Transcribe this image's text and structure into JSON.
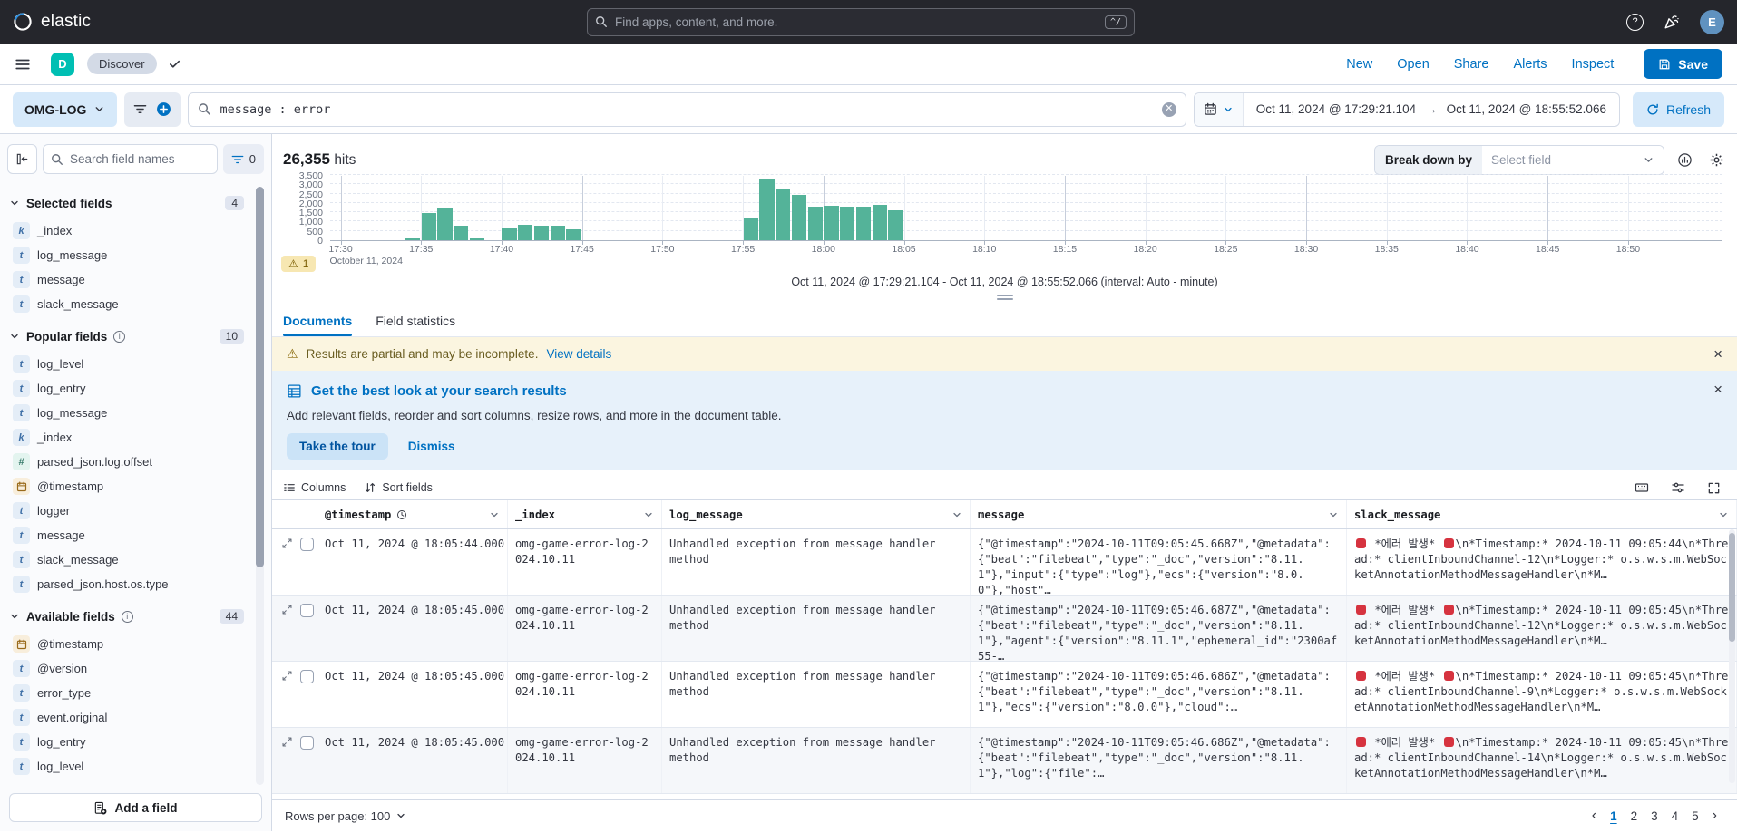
{
  "header": {
    "logo_text": "elastic",
    "search_placeholder": "Find apps, content, and more.",
    "shortcut": "^/",
    "avatar_initial": "E"
  },
  "nav": {
    "space_initial": "D",
    "breadcrumb": "Discover",
    "links": [
      "New",
      "Open",
      "Share",
      "Alerts",
      "Inspect"
    ],
    "save_label": "Save"
  },
  "query_bar": {
    "data_view": "OMG-LOG",
    "query": "message : error",
    "date_from": "Oct 11, 2024 @ 17:29:21.104",
    "date_to": "Oct 11, 2024 @ 18:55:52.066",
    "refresh_label": "Refresh"
  },
  "sidebar": {
    "search_placeholder": "Search field names",
    "filter_count": "0",
    "sections": [
      {
        "title": "Selected fields",
        "count": "4",
        "info": false,
        "fields": [
          {
            "type": "keyword",
            "label": "_index"
          },
          {
            "type": "text",
            "label": "log_message"
          },
          {
            "type": "text",
            "label": "message"
          },
          {
            "type": "text",
            "label": "slack_message"
          }
        ]
      },
      {
        "title": "Popular fields",
        "count": "10",
        "info": true,
        "fields": [
          {
            "type": "text",
            "label": "log_level"
          },
          {
            "type": "text",
            "label": "log_entry"
          },
          {
            "type": "text",
            "label": "log_message"
          },
          {
            "type": "keyword",
            "label": "_index"
          },
          {
            "type": "number",
            "label": "parsed_json.log.offset"
          },
          {
            "type": "date",
            "label": "@timestamp"
          },
          {
            "type": "text",
            "label": "logger"
          },
          {
            "type": "text",
            "label": "message"
          },
          {
            "type": "text",
            "label": "slack_message"
          },
          {
            "type": "text",
            "label": "parsed_json.host.os.type"
          }
        ]
      },
      {
        "title": "Available fields",
        "count": "44",
        "info": true,
        "fields": [
          {
            "type": "date",
            "label": "@timestamp"
          },
          {
            "type": "text",
            "label": "@version"
          },
          {
            "type": "text",
            "label": "error_type"
          },
          {
            "type": "text",
            "label": "event.original"
          },
          {
            "type": "text",
            "label": "log_entry"
          },
          {
            "type": "text",
            "label": "log_level"
          }
        ]
      }
    ],
    "add_field_label": "Add a field"
  },
  "results": {
    "hits_count": "26,355",
    "hits_label": "hits",
    "breakdown_label": "Break down by",
    "breakdown_placeholder": "Select field",
    "warning_count": "1",
    "chart_caption": "Oct 11, 2024 @ 17:29:21.104 - Oct 11, 2024 @ 18:55:52.066 (interval: Auto - minute)",
    "tabs": [
      "Documents",
      "Field statistics"
    ],
    "partial_warning": "Results are partial and may be incomplete.",
    "view_details": "View details",
    "tour_title": "Get the best look at your search results",
    "tour_body": "Add relevant fields, reorder and sort columns, resize rows, and more in the document table.",
    "tour_button": "Take the tour",
    "dismiss": "Dismiss"
  },
  "chart_data": {
    "type": "bar",
    "title": "26,355 hits",
    "x": [
      "17:34",
      "17:35",
      "17:36",
      "17:37",
      "17:38",
      "17:40",
      "17:41",
      "17:42",
      "17:43",
      "17:44",
      "17:55",
      "17:56",
      "17:57",
      "17:58",
      "17:59",
      "18:00",
      "18:01",
      "18:02",
      "18:03",
      "18:04"
    ],
    "values": [
      100,
      1450,
      1700,
      800,
      100,
      650,
      850,
      780,
      780,
      580,
      1150,
      3250,
      2750,
      2450,
      1800,
      1850,
      1800,
      1800,
      1900,
      1600
    ],
    "x_axis_start": "17:29:21",
    "x_axis_end": "18:55:52",
    "x_ticks": [
      "17:30",
      "17:35",
      "17:40",
      "17:45",
      "17:50",
      "17:55",
      "18:00",
      "18:05",
      "18:10",
      "18:15",
      "18:20",
      "18:25",
      "18:30",
      "18:35",
      "18:40",
      "18:45",
      "18:50"
    ],
    "y_ticks": [
      0,
      500,
      1000,
      1500,
      2000,
      2500,
      3000,
      3500
    ],
    "ylim": [
      0,
      3500
    ],
    "xlabel": "October 11, 2024",
    "ylabel": "",
    "bar_color": "#54B399",
    "interval": "Auto - minute",
    "grid": true,
    "legend": false
  },
  "table": {
    "toolbar": {
      "columns_label": "Columns",
      "sort_label": "Sort fields"
    },
    "headers": [
      "@timestamp",
      "_index",
      "log_message",
      "message",
      "slack_message"
    ],
    "rows": [
      {
        "timestamp": "Oct 11, 2024 @ 18:05:44.000",
        "index": "omg-game-error-log-2024.10.11",
        "log_message": "Unhandled exception from message handler method",
        "message": "{\"@timestamp\":\"2024-10-11T09:05:45.668Z\",\"@metadata\":{\"beat\":\"filebeat\",\"type\":\"_doc\",\"version\":\"8.11.1\"},\"input\":{\"type\":\"log\"},\"ecs\":{\"version\":\"8.0.0\"},\"host\"…",
        "slack_message": "🚨 *에러 발생* 🚨\\n*Timestamp:* 2024-10-11 09:05:44\\n*Thread:* clientInboundChannel-12\\n*Logger:* o.s.w.s.m.WebSocketAnnotationMethodMessageHandler\\n*M…"
      },
      {
        "timestamp": "Oct 11, 2024 @ 18:05:45.000",
        "index": "omg-game-error-log-2024.10.11",
        "log_message": "Unhandled exception from message handler method",
        "message": "{\"@timestamp\":\"2024-10-11T09:05:46.687Z\",\"@metadata\":{\"beat\":\"filebeat\",\"type\":\"_doc\",\"version\":\"8.11.1\"},\"agent\":{\"version\":\"8.11.1\",\"ephemeral_id\":\"2300af55-…",
        "slack_message": "🚨 *에러 발생* 🚨\\n*Timestamp:* 2024-10-11 09:05:45\\n*Thread:* clientInboundChannel-12\\n*Logger:* o.s.w.s.m.WebSocketAnnotationMethodMessageHandler\\n*M…"
      },
      {
        "timestamp": "Oct 11, 2024 @ 18:05:45.000",
        "index": "omg-game-error-log-2024.10.11",
        "log_message": "Unhandled exception from message handler method",
        "message": "{\"@timestamp\":\"2024-10-11T09:05:46.686Z\",\"@metadata\":{\"beat\":\"filebeat\",\"type\":\"_doc\",\"version\":\"8.11.1\"},\"ecs\":{\"version\":\"8.0.0\"},\"cloud\":…",
        "slack_message": "🚨 *에러 발생* 🚨\\n*Timestamp:* 2024-10-11 09:05:45\\n*Thread:* clientInboundChannel-9\\n*Logger:* o.s.w.s.m.WebSocketAnnotationMethodMessageHandler\\n*M…"
      },
      {
        "timestamp": "Oct 11, 2024 @ 18:05:45.000",
        "index": "omg-game-error-log-2024.10.11",
        "log_message": "Unhandled exception from message handler method",
        "message": "{\"@timestamp\":\"2024-10-11T09:05:46.686Z\",\"@metadata\":{\"beat\":\"filebeat\",\"type\":\"_doc\",\"version\":\"8.11.1\"},\"log\":{\"file\":…",
        "slack_message": "🚨 *에러 발생* 🚨\\n*Timestamp:* 2024-10-11 09:05:45\\n*Thread:* clientInboundChannel-14\\n*Logger:* o.s.w.s.m.WebSocketAnnotationMethodMessageHandler\\n*M…"
      }
    ],
    "footer": {
      "rows_per_page": "Rows per page: 100",
      "pages": [
        "1",
        "2",
        "3",
        "4",
        "5"
      ],
      "active_page": "1"
    }
  }
}
